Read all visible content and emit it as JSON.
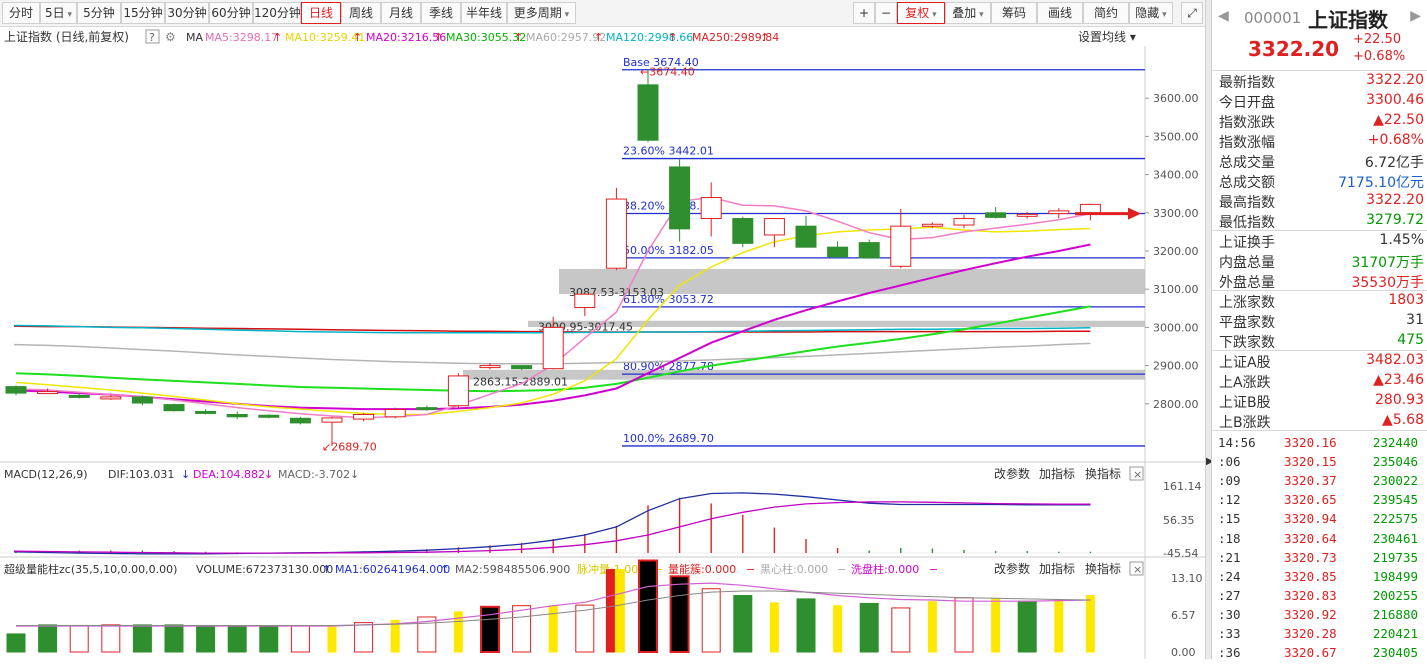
{
  "toolbar": {
    "left": [
      {
        "label": "分时",
        "dd": false
      },
      {
        "label": "5日",
        "dd": true
      },
      {
        "label": "5分钟",
        "dd": false
      },
      {
        "label": "15分钟",
        "dd": false
      },
      {
        "label": "30分钟",
        "dd": false
      },
      {
        "label": "60分钟",
        "dd": false
      },
      {
        "label": "120分钟",
        "dd": false
      },
      {
        "label": "日线",
        "dd": false,
        "active": true
      },
      {
        "label": "周线",
        "dd": false
      },
      {
        "label": "月线",
        "dd": false
      },
      {
        "label": "季线",
        "dd": false
      },
      {
        "label": "半年线",
        "dd": false
      },
      {
        "label": "更多周期",
        "dd": true
      }
    ],
    "plus": "+",
    "minus": "−",
    "right": [
      {
        "label": "复权",
        "dd": true,
        "active": true
      },
      {
        "label": "叠加",
        "dd": true
      },
      {
        "label": "筹码"
      },
      {
        "label": "画线"
      },
      {
        "label": "简约"
      },
      {
        "label": "隐藏",
        "dd": true
      }
    ],
    "expand_icon": "expand-icon"
  },
  "main_header": {
    "title": "上证指数 (日线,前复权)",
    "help": "?",
    "ma": "MA",
    "ma_items": [
      {
        "label": "MA5:3298.17",
        "arrow": "↑",
        "color": "#e06fb8"
      },
      {
        "label": "MA10:3259.41",
        "arrow": "↑",
        "color": "#e6d200"
      },
      {
        "label": "MA20:3216.56",
        "arrow": "↑",
        "color": "#d000d0"
      },
      {
        "label": "MA30:3055.32",
        "arrow": "↑",
        "color": "#00b400"
      },
      {
        "label": "MA60:2957.92",
        "arrow": "↑",
        "color": "#aaaaaa"
      },
      {
        "label": "MA120:2998.66",
        "arrow": "↑",
        "color": "#00b4c8"
      },
      {
        "label": "MA250:2989.84",
        "arrow": "↑",
        "color": "#e02020"
      }
    ],
    "settings": "设置均线"
  },
  "price_axis": [
    "3600.00",
    "3500.00",
    "3400.00",
    "3300.00",
    "3200.00",
    "3100.00",
    "3000.00",
    "2900.00",
    "2800.00"
  ],
  "fib_labels": [
    "Base   3674.40",
    "23.60% 3442.01",
    "38.20% 3298.24",
    "50.00% 3182.05",
    "61.80% 3053.72",
    "80.90% 2877.78",
    "100.0% 2689.70"
  ],
  "annotations": {
    "high": "3674.40",
    "low": "2689.70",
    "gap1": "3087.53-3153.03",
    "gap2": "3000.95-3017.45",
    "gap3": "2863.15-2889.01"
  },
  "macd_header": {
    "name": "MACD(12,26,9)",
    "dif": "DIF:103.031",
    "dif_arrow": "↓",
    "dea": "DEA:104.882",
    "dea_arrow": "↓",
    "macd": "MACD:-3.702",
    "macd_arrow": "↓",
    "params": "改参数",
    "add": "加指标",
    "switch": "换指标",
    "close": "×"
  },
  "macd_axis": [
    "161.14",
    "56.35",
    "-45.54"
  ],
  "vol_header": {
    "name": "超级量能柱zc(35,5,10,0.00,0.00)",
    "volume": "VOLUME:672373130.000",
    "vol_arrow": "↑",
    "ma1": "MA1:602641964.000",
    "ma1_arrow": "↑",
    "ma2": "MA2:598485506.900",
    "pulse": "脉冲量:1.000",
    "pulse_dash": "−",
    "energy": "量能簇:0.000",
    "energy_dash": "−",
    "black": "黑心柱:0.000",
    "black_dash": "−",
    "wash": "洗盘柱:0.000",
    "wash_dash": "−",
    "params": "改参数",
    "add": "加指标",
    "switch": "换指标",
    "close": "×"
  },
  "vol_axis": [
    "13.10",
    "6.57",
    "0.00"
  ],
  "chart_data": {
    "type": "candlestick",
    "candles": [
      {
        "o": 2845,
        "h": 2848,
        "l": 2822,
        "c": 2828
      },
      {
        "o": 2832,
        "h": 2840,
        "l": 2826,
        "c": 2832
      },
      {
        "o": 2822,
        "h": 2828,
        "l": 2814,
        "c": 2818
      },
      {
        "o": 2818,
        "h": 2824,
        "l": 2810,
        "c": 2818
      },
      {
        "o": 2818,
        "h": 2822,
        "l": 2796,
        "c": 2802
      },
      {
        "o": 2798,
        "h": 2800,
        "l": 2780,
        "c": 2782
      },
      {
        "o": 2780,
        "h": 2786,
        "l": 2772,
        "c": 2778
      },
      {
        "o": 2772,
        "h": 2780,
        "l": 2760,
        "c": 2766
      },
      {
        "o": 2770,
        "h": 2772,
        "l": 2762,
        "c": 2766
      },
      {
        "o": 2762,
        "h": 2766,
        "l": 2746,
        "c": 2750
      },
      {
        "o": 2752,
        "h": 2766,
        "l": 2690,
        "c": 2763
      },
      {
        "o": 2760,
        "h": 2776,
        "l": 2754,
        "c": 2772
      },
      {
        "o": 2766,
        "h": 2790,
        "l": 2762,
        "c": 2785
      },
      {
        "o": 2790,
        "h": 2795,
        "l": 2782,
        "c": 2788
      },
      {
        "o": 2795,
        "h": 2880,
        "l": 2790,
        "c": 2873
      },
      {
        "o": 2896,
        "h": 2906,
        "l": 2890,
        "c": 2900
      },
      {
        "o": 2900,
        "h": 2900,
        "l": 2888,
        "c": 2892
      },
      {
        "o": 2892,
        "h": 3028,
        "l": 2890,
        "c": 3000
      },
      {
        "o": 3052,
        "h": 3090,
        "l": 3030,
        "c": 3087
      },
      {
        "o": 3155,
        "h": 3365,
        "l": 3150,
        "c": 3336
      },
      {
        "o": 3635,
        "h": 3674,
        "l": 3485,
        "c": 3490
      },
      {
        "o": 3420,
        "h": 3440,
        "l": 3225,
        "c": 3258
      },
      {
        "o": 3285,
        "h": 3380,
        "l": 3238,
        "c": 3340
      },
      {
        "o": 3285,
        "h": 3290,
        "l": 3210,
        "c": 3220
      },
      {
        "o": 3242,
        "h": 3280,
        "l": 3210,
        "c": 3285
      },
      {
        "o": 3265,
        "h": 3292,
        "l": 3215,
        "c": 3210
      },
      {
        "o": 3210,
        "h": 3225,
        "l": 3180,
        "c": 3185
      },
      {
        "o": 3222,
        "h": 3230,
        "l": 3180,
        "c": 3182
      },
      {
        "o": 3160,
        "h": 3310,
        "l": 3155,
        "c": 3265
      },
      {
        "o": 3265,
        "h": 3275,
        "l": 3260,
        "c": 3270
      },
      {
        "o": 3268,
        "h": 3295,
        "l": 3260,
        "c": 3285
      },
      {
        "o": 3300,
        "h": 3315,
        "l": 3285,
        "c": 3288
      },
      {
        "o": 3292,
        "h": 3302,
        "l": 3285,
        "c": 3296
      },
      {
        "o": 3298,
        "h": 3312,
        "l": 3285,
        "c": 3305
      },
      {
        "o": 3300,
        "h": 3324,
        "l": 3280,
        "c": 3322
      }
    ],
    "ma5": [
      2839,
      2836,
      2830,
      2824,
      2818,
      2810,
      2800,
      2790,
      2782,
      2774,
      2768,
      2764,
      2766,
      2772,
      2796,
      2825,
      2853,
      2902,
      2972,
      3040,
      3200,
      3330,
      3340,
      3320,
      3318,
      3305,
      3278,
      3248,
      3230,
      3235,
      3250,
      3260,
      3270,
      3282,
      3298
    ],
    "ma10": [
      2856,
      2850,
      2843,
      2836,
      2828,
      2819,
      2810,
      2800,
      2792,
      2786,
      2780,
      2775,
      2772,
      2772,
      2780,
      2790,
      2802,
      2825,
      2860,
      2918,
      3020,
      3110,
      3158,
      3196,
      3224,
      3240,
      3250,
      3255,
      3258,
      3262,
      3255,
      3250,
      3252,
      3256,
      3259
    ],
    "ma20": [
      2835,
      2832,
      2828,
      2824,
      2818,
      2812,
      2806,
      2800,
      2794,
      2790,
      2788,
      2786,
      2786,
      2786,
      2788,
      2792,
      2798,
      2808,
      2822,
      2840,
      2880,
      2920,
      2960,
      2990,
      3020,
      3045,
      3068,
      3090,
      3110,
      3130,
      3150,
      3168,
      3185,
      3200,
      3217
    ],
    "ma30": [
      2880,
      2877,
      2873,
      2868,
      2864,
      2860,
      2856,
      2852,
      2848,
      2844,
      2842,
      2840,
      2838,
      2836,
      2834,
      2833,
      2834,
      2836,
      2842,
      2852,
      2868,
      2885,
      2900,
      2912,
      2925,
      2938,
      2950,
      2960,
      2970,
      2982,
      2995,
      3010,
      3025,
      3040,
      3055
    ],
    "ma60": [
      2955,
      2953,
      2950,
      2946,
      2942,
      2938,
      2933,
      2928,
      2924,
      2920,
      2916,
      2913,
      2910,
      2908,
      2906,
      2905,
      2905,
      2905,
      2906,
      2908,
      2910,
      2912,
      2915,
      2918,
      2921,
      2924,
      2928,
      2932,
      2936,
      2940,
      2944,
      2948,
      2951,
      2955,
      2958
    ],
    "ma120": [
      3005,
      3004,
      3002,
      3000,
      2999,
      2997,
      2995,
      2993,
      2991,
      2989,
      2988,
      2987,
      2986,
      2986,
      2986,
      2986,
      2986,
      2986,
      2987,
      2987,
      2988,
      2988,
      2989,
      2990,
      2991,
      2992,
      2993,
      2994,
      2995,
      2995,
      2996,
      2997,
      2997,
      2998,
      2999
    ],
    "ma250": [
      3003,
      3002,
      3002,
      3001,
      3000,
      2999,
      2998,
      2997,
      2996,
      2995,
      2994,
      2993,
      2992,
      2991,
      2990,
      2990,
      2989,
      2989,
      2988,
      2988,
      2988,
      2988,
      2988,
      2988,
      2988,
      2988,
      2989,
      2989,
      2989,
      2989,
      2989,
      2989,
      2989,
      2990,
      2990
    ],
    "fib_levels": [
      3674.4,
      3442.01,
      3298.24,
      3182.05,
      3053.72,
      2877.78,
      2689.7
    ],
    "gaps": [
      [
        3087.53,
        3153.03
      ],
      [
        3000.95,
        3017.45
      ],
      [
        2863.15,
        2889.01
      ]
    ],
    "price_ylim": [
      2700,
      3700
    ],
    "macd_dif": [
      -42,
      -44,
      -46,
      -47,
      -48,
      -48,
      -48,
      -47,
      -46,
      -45,
      -44,
      -42,
      -40,
      -37,
      -32,
      -26,
      -18,
      -6,
      10,
      35,
      85,
      122,
      138,
      140,
      136,
      128,
      118,
      108,
      104,
      104,
      104,
      104,
      103,
      103,
      103
    ],
    "macd_dea": [
      -40,
      -41,
      -42,
      -43,
      -44,
      -45,
      -46,
      -46,
      -46,
      -46,
      -45,
      -45,
      -44,
      -43,
      -41,
      -38,
      -34,
      -28,
      -20,
      -8,
      10,
      35,
      60,
      80,
      96,
      106,
      110,
      112,
      112,
      111,
      109,
      107,
      106,
      105,
      105
    ],
    "macd_hist": [
      -4,
      -6,
      -8,
      -8,
      -8,
      -6,
      -4,
      -2,
      0,
      2,
      2,
      6,
      8,
      12,
      18,
      24,
      32,
      44,
      60,
      86,
      150,
      174,
      156,
      120,
      80,
      44,
      16,
      -8,
      -16,
      -14,
      -10,
      -6,
      -6,
      -4,
      -4
    ],
    "macd_ylim": [
      -45.54,
      161.14
    ],
    "volume": [
      3.2,
      4.8,
      4.7,
      4.8,
      4.8,
      4.8,
      4.7,
      4.6,
      4.6,
      4.6,
      4.4,
      5.2,
      5.6,
      6.2,
      7.1,
      8.0,
      8.2,
      8.2,
      8.3,
      14.6,
      16.2,
      13.4,
      11.2,
      10.0,
      8.7,
      9.4,
      8.2,
      8.6,
      7.8,
      8.9,
      9.6,
      9.4,
      9.0,
      9.2,
      10.0
    ],
    "vol_type": [
      "g",
      "g",
      "r",
      "r",
      "g",
      "g",
      "g",
      "g",
      "g",
      "r",
      "y",
      "r",
      "y",
      "r",
      "y",
      "b",
      "r",
      "y",
      "r",
      "y",
      "b",
      "b",
      "r",
      "g",
      "y",
      "g",
      "y",
      "g",
      "r",
      "y",
      "r",
      "y",
      "g",
      "y",
      "y"
    ],
    "vol_ma1": [
      4.6,
      4.6,
      4.6,
      4.6,
      4.6,
      4.6,
      4.6,
      4.6,
      4.6,
      4.6,
      4.6,
      4.8,
      5.0,
      5.4,
      6.0,
      6.6,
      7.4,
      8.2,
      8.8,
      10.2,
      11.6,
      12.0,
      12.2,
      11.8,
      11.2,
      10.6,
      10.0,
      9.6,
      9.3,
      9.2,
      9.0,
      9.0,
      9.0,
      9.1,
      9.2
    ],
    "vol_ma2": [
      4.7,
      4.7,
      4.7,
      4.7,
      4.7,
      4.7,
      4.7,
      4.7,
      4.7,
      4.7,
      4.7,
      4.8,
      4.9,
      5.1,
      5.4,
      5.8,
      6.2,
      6.8,
      7.4,
      8.2,
      9.2,
      10.0,
      10.6,
      10.8,
      10.8,
      10.6,
      10.4,
      10.2,
      10.0,
      9.8,
      9.6,
      9.5,
      9.4,
      9.3,
      9.2
    ],
    "vol_ylim": [
      0,
      17.5
    ]
  },
  "right_panel": {
    "code": "000001",
    "name": "上证指数",
    "price": "3322.20",
    "change": "+22.50",
    "pct": "+0.68%",
    "rows": [
      {
        "label": "最新指数",
        "value": "3322.20",
        "cls": "red"
      },
      {
        "label": "今日开盘",
        "value": "3300.46",
        "cls": "red"
      },
      {
        "label": "指数涨跌",
        "value": "▲22.50",
        "cls": "red"
      },
      {
        "label": "指数涨幅",
        "value": "+0.68%",
        "cls": "red"
      },
      {
        "label": "总成交量",
        "value": "6.72亿手",
        "cls": "dark"
      },
      {
        "label": "总成交额",
        "value": "7175.10亿元",
        "cls": "blue"
      },
      {
        "label": "最高指数",
        "value": "3322.20",
        "cls": "red"
      },
      {
        "label": "最低指数",
        "value": "3279.72",
        "cls": "green"
      },
      {
        "label": "上证换手",
        "value": "1.45%",
        "cls": "dark"
      },
      {
        "label": "内盘总量",
        "value": "31707万手",
        "cls": "green"
      },
      {
        "label": "外盘总量",
        "value": "35530万手",
        "cls": "red"
      },
      {
        "label": "上涨家数",
        "value": "1803",
        "cls": "red"
      },
      {
        "label": "平盘家数",
        "value": "31",
        "cls": "dark"
      },
      {
        "label": "下跌家数",
        "value": "475",
        "cls": "green"
      },
      {
        "label": "上证A股",
        "value": "3482.03",
        "cls": "red"
      },
      {
        "label": "上A涨跌",
        "value": "▲23.46",
        "cls": "red"
      },
      {
        "label": "上证B股",
        "value": "280.93",
        "cls": "red"
      },
      {
        "label": "上B涨跌",
        "value": "▲5.68",
        "cls": "red"
      }
    ],
    "ticks": [
      {
        "t": "14:56",
        "p": "3320.16",
        "q": "232440"
      },
      {
        "t": ":06",
        "p": "3320.15",
        "q": "235046"
      },
      {
        "t": ":09",
        "p": "3320.37",
        "q": "230022"
      },
      {
        "t": ":12",
        "p": "3320.65",
        "q": "239545"
      },
      {
        "t": ":15",
        "p": "3320.94",
        "q": "222575"
      },
      {
        "t": ":18",
        "p": "3320.64",
        "q": "230461"
      },
      {
        "t": ":21",
        "p": "3320.73",
        "q": "219735"
      },
      {
        "t": ":24",
        "p": "3320.85",
        "q": "198499"
      },
      {
        "t": ":27",
        "p": "3320.83",
        "q": "200255"
      },
      {
        "t": ":30",
        "p": "3320.92",
        "q": "216880"
      },
      {
        "t": ":33",
        "p": "3320.28",
        "q": "220421"
      },
      {
        "t": ":36",
        "p": "3320.67",
        "q": "230405"
      }
    ]
  }
}
